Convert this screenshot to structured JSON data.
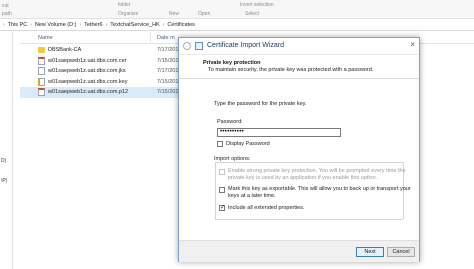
{
  "ribbon": {
    "folder_label": "folder",
    "organize_label": "Organize",
    "new_label": "New",
    "open_label": "Open",
    "select_label": "Select",
    "invert_selection_label": "Invert selection",
    "copy_path_label": "path",
    "left_fragment": "cut"
  },
  "address_bar": {
    "crumbs": [
      "This PC",
      "New Volume (D:)",
      "Tether6",
      "TextchatService_HK",
      "Certificates"
    ]
  },
  "nav_pane": {
    "items": [
      "D)",
      "\\P)"
    ]
  },
  "columns": {
    "name": "Name",
    "date": "Date m"
  },
  "files": [
    {
      "name": "DBSBank-CA",
      "date": "7/17/201",
      "icon": "folder-icon"
    },
    {
      "name": "w01saepweb1z.uat.dbs.com.cer",
      "date": "7/15/201",
      "icon": "certificate-file-icon"
    },
    {
      "name": "w01saepweb1z.uat.dbs.com.jks",
      "date": "7/17/201",
      "icon": "document-file-icon"
    },
    {
      "name": "w01saepweb1z.uat.dbs.com.key",
      "date": "7/15/201",
      "icon": "key-file-icon"
    },
    {
      "name": "w01saepweb1z.uat.dbs.com.p12",
      "date": "7/15/201",
      "icon": "certificate-file-icon"
    }
  ],
  "dialog": {
    "title": "Certificate Import Wizard",
    "section_title": "Private key protection",
    "section_desc": "To maintain security, the private key was protected with a password.",
    "prompt": "Type the password for the private key.",
    "password_label": "Password:",
    "password_value": "••••••••••",
    "display_password_label": "Display Password",
    "import_options_label": "Import options:",
    "option1_line1": "Enable strong private key protection. You will be prompted every time the",
    "option1_line2": "private key is used by an application if you enable this option.",
    "option2_line1": "Mark this key as exportable. This will allow you to back up or transport your",
    "option2_line2": "keys at a later time.",
    "option3_label": "Include all extended properties.",
    "next_label": "Next",
    "cancel_label": "Cancel"
  }
}
